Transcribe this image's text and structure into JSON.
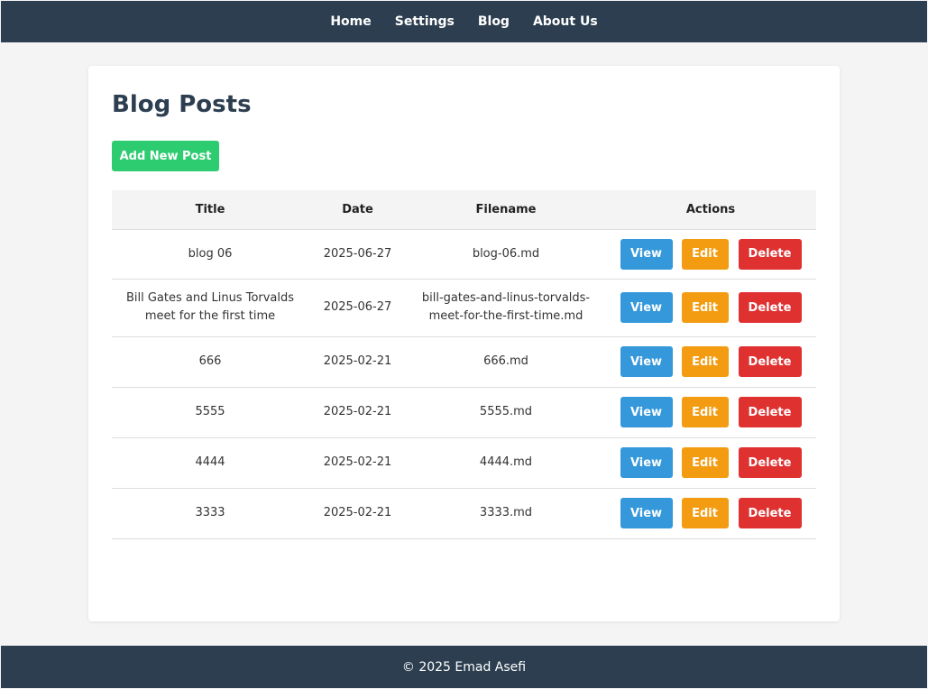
{
  "nav": {
    "items": [
      "Home",
      "Settings",
      "Blog",
      "About Us"
    ]
  },
  "page": {
    "title": "Blog Posts",
    "add_button": "Add New Post"
  },
  "table": {
    "headers": [
      "Title",
      "Date",
      "Filename",
      "Actions"
    ],
    "rows": [
      {
        "title": "blog 06",
        "date": "2025-06-27",
        "filename": "blog-06.md"
      },
      {
        "title": "Bill Gates and Linus Torvalds meet for the first time",
        "date": "2025-06-27",
        "filename": "bill-gates-and-linus-torvalds-meet-for-the-first-time.md"
      },
      {
        "title": "666",
        "date": "2025-02-21",
        "filename": "666.md"
      },
      {
        "title": "5555",
        "date": "2025-02-21",
        "filename": "5555.md"
      },
      {
        "title": "4444",
        "date": "2025-02-21",
        "filename": "4444.md"
      },
      {
        "title": "3333",
        "date": "2025-02-21",
        "filename": "3333.md"
      }
    ],
    "actions": {
      "view": "View",
      "edit": "Edit",
      "delete": "Delete"
    }
  },
  "footer": {
    "text": "© 2025 Emad Asefi"
  },
  "colors": {
    "nav_bg": "#2c3e50",
    "add": "#2ecc71",
    "view": "#3498db",
    "edit": "#f39c12",
    "delete": "#e03131"
  }
}
